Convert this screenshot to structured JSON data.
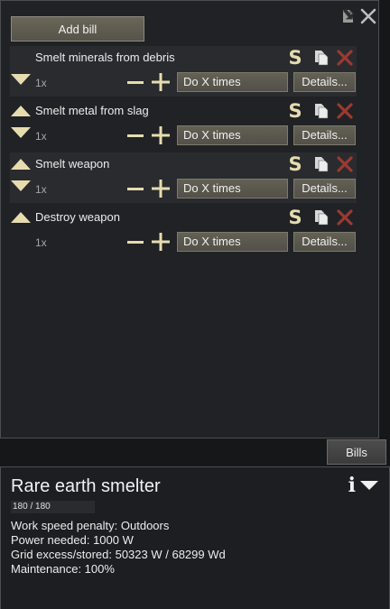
{
  "bills_panel": {
    "add_bill_label": "Add bill",
    "bills": [
      {
        "name": "Smelt minerals from debris",
        "count": "1x",
        "repeat_mode": "Do X times",
        "details_label": "Details...",
        "has_up": false,
        "has_down": true
      },
      {
        "name": "Smelt metal from slag",
        "count": "1x",
        "repeat_mode": "Do X times",
        "details_label": "Details...",
        "has_up": true,
        "has_down": true
      },
      {
        "name": "Smelt weapon",
        "count": "1x",
        "repeat_mode": "Do X times",
        "details_label": "Details...",
        "has_up": true,
        "has_down": true
      },
      {
        "name": "Destroy weapon",
        "count": "1x",
        "repeat_mode": "Do X times",
        "details_label": "Details...",
        "has_up": true,
        "has_down": false
      }
    ],
    "suspend_glyph": "S"
  },
  "tabs": {
    "bills_label": "Bills"
  },
  "building": {
    "title": "Rare earth smelter",
    "hit_points": "180 / 180",
    "hp_fraction": 1.0,
    "info_glyph": "i",
    "lines": [
      "Work speed penalty: Outdoors",
      "Power needed: 1000 W",
      "Grid excess/stored: 50323 W / 68299 Wd",
      "Maintenance: 100%"
    ]
  },
  "colors": {
    "accent_cream": "#e6dcb0",
    "delete_red": "#9a3a32",
    "button_khaki": "#5c594f"
  },
  "icons": [
    "paste-icon",
    "close-icon",
    "reorder-up-icon",
    "reorder-down-icon",
    "suspend-icon",
    "copy-icon",
    "delete-icon",
    "decrease-icon",
    "increase-icon",
    "info-icon",
    "dropdown-icon"
  ]
}
